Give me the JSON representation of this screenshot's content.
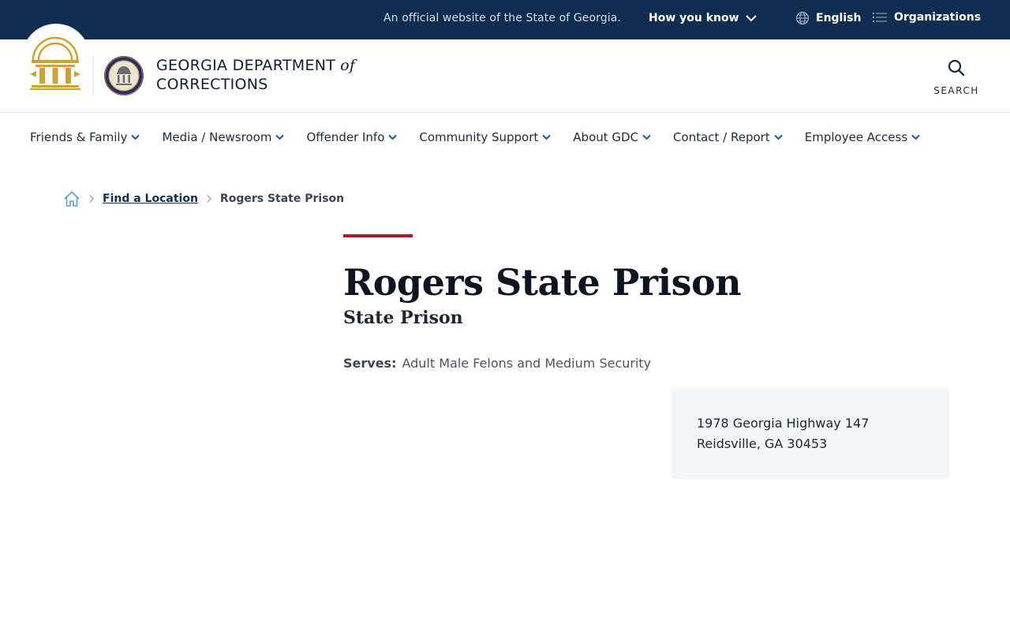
{
  "topbar": {
    "official_text": "An official website of the State of Georgia.",
    "how_you_know": "How you know",
    "language": "English",
    "organizations": "Organizations"
  },
  "header": {
    "dept_name_line1": "GEORGIA DEPARTMENT",
    "dept_name_of": "of",
    "dept_name_line2": "CORRECTIONS",
    "search_label": "SEARCH"
  },
  "nav": {
    "items": [
      {
        "label": "Friends & Family"
      },
      {
        "label": "Media / Newsroom"
      },
      {
        "label": "Offender Info"
      },
      {
        "label": "Community Support"
      },
      {
        "label": "About GDC"
      },
      {
        "label": "Contact / Report"
      },
      {
        "label": "Employee Access"
      }
    ]
  },
  "breadcrumb": {
    "items": [
      {
        "label": "Find a Location"
      },
      {
        "label": "Rogers State Prison"
      }
    ]
  },
  "main": {
    "title": "Rogers State Prison",
    "subtitle": "State Prison",
    "serves_label": "Serves:",
    "serves_value": "Adult Male Felons and Medium Security",
    "address": {
      "line1": "1978 Georgia Highway 147",
      "line2": "Reidsville, GA 30453"
    }
  },
  "colors": {
    "topbar_bg": "#102f50",
    "accent_red": "#b0171f",
    "seal_gold": "#c9a23a",
    "nav_chevron": "#1d5b8f",
    "address_bg": "#f3f6f9"
  }
}
